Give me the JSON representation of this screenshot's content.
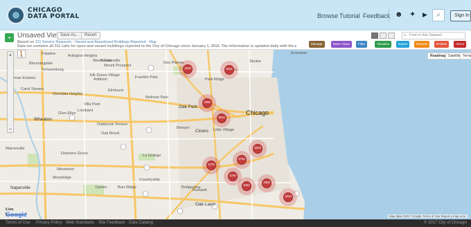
{
  "header": {
    "brand_line1": "CHICAGO",
    "brand_line2": "DATA PORTAL",
    "nav": [
      "Browse",
      "Tutorial",
      "Feedback"
    ],
    "icons": [
      "github-icon",
      "twitter-icon",
      "youtube-icon"
    ],
    "search_icon": "search-icon",
    "sign_in": "Sign In"
  },
  "toolbar": {
    "view_title": "Unsaved View",
    "save_as": "Save As...",
    "revert": "Revert",
    "based_prefix": "Based on",
    "based_link": "311 Service Requests - Vacant and Abandoned Buildings Reported - Map",
    "updated_text": "Data set contains all 311 calls for open and vacant buildings reported to the City of Chicago since January 1, 2010. The information is updated daily with the",
    "updated_more": "▸",
    "find_placeholder": "Find in this Dataset",
    "actions": [
      {
        "label": "Manage",
        "color": "#8a6437"
      },
      {
        "label": "More Views",
        "color": "#8b56c9"
      },
      {
        "label": "Filter",
        "color": "#3b83c4"
      },
      {
        "label": "Visualize",
        "color": "#2e9a4c"
      },
      {
        "label": "Export",
        "color": "#25a0d8"
      },
      {
        "label": "Discuss",
        "color": "#f08a17"
      },
      {
        "label": "Embed",
        "color": "#e3553d"
      },
      {
        "label": "About",
        "color": "#c12a2a"
      }
    ]
  },
  "map": {
    "types": [
      "Roadmap",
      "Satellite",
      "Terrain"
    ],
    "selected_type": "Roadmap",
    "places": [
      {
        "name": "Palatine",
        "cls": ""
      },
      {
        "name": "Evanston",
        "cls": ""
      },
      {
        "name": "Skokie",
        "cls": ""
      },
      {
        "name": "Des Plaines",
        "cls": ""
      },
      {
        "name": "Park Ridge",
        "cls": ""
      },
      {
        "name": "Niles",
        "cls": ""
      },
      {
        "name": "Arlington Heights",
        "cls": ""
      },
      {
        "name": "Mount Prospect",
        "cls": ""
      },
      {
        "name": "Elk Grove Village",
        "cls": ""
      },
      {
        "name": "Schaumburg",
        "cls": ""
      },
      {
        "name": "Hoffman Estates",
        "cls": ""
      },
      {
        "name": "Addison",
        "cls": ""
      },
      {
        "name": "Franklin Park",
        "cls": ""
      },
      {
        "name": "Bensenville",
        "cls": ""
      },
      {
        "name": "Wood Dale",
        "cls": ""
      },
      {
        "name": "Elmhurst",
        "cls": ""
      },
      {
        "name": "Melrose Park",
        "cls": ""
      },
      {
        "name": "Oak Park",
        "cls": "mid"
      },
      {
        "name": "Chicago",
        "cls": "city"
      },
      {
        "name": "Cicero",
        "cls": "mid"
      },
      {
        "name": "Berwyn",
        "cls": ""
      },
      {
        "name": "Villa Park",
        "cls": ""
      },
      {
        "name": "Lombard",
        "cls": ""
      },
      {
        "name": "Glen Ellyn",
        "cls": ""
      },
      {
        "name": "Wheaton",
        "cls": "mid"
      },
      {
        "name": "Oakbrook Terrace",
        "cls": ""
      },
      {
        "name": "Oak Brook",
        "cls": ""
      },
      {
        "name": "Glendale Heights",
        "cls": ""
      },
      {
        "name": "Carol Stream",
        "cls": ""
      },
      {
        "name": "Bloomingdale",
        "cls": ""
      },
      {
        "name": "Downers Grove",
        "cls": ""
      },
      {
        "name": "Westmont",
        "cls": ""
      },
      {
        "name": "Warrenville",
        "cls": ""
      },
      {
        "name": "La Grange",
        "cls": ""
      },
      {
        "name": "Darien",
        "cls": ""
      },
      {
        "name": "Burr Ridge",
        "cls": ""
      },
      {
        "name": "Countryside",
        "cls": ""
      },
      {
        "name": "Bridgeview",
        "cls": ""
      },
      {
        "name": "Burbank",
        "cls": ""
      },
      {
        "name": "Oak Lawn",
        "cls": "mid"
      },
      {
        "name": "Naperville",
        "cls": "mid"
      },
      {
        "name": "Woodridge",
        "cls": ""
      },
      {
        "name": "Little Village",
        "cls": ""
      }
    ],
    "clusters": [
      {
        "label": "1028"
      },
      {
        "label": "2841"
      },
      {
        "label": "1965"
      },
      {
        "label": "3542"
      },
      {
        "label": "2848"
      },
      {
        "label": "1376"
      },
      {
        "label": "2754"
      },
      {
        "label": "1240"
      },
      {
        "label": "4891"
      },
      {
        "label": "2859"
      },
      {
        "label": "3333"
      }
    ],
    "scale": "5 km",
    "google": "Google",
    "footer_text": "Map data ©2017 Google  Terms of Use  Report a map error"
  },
  "footer": {
    "links": [
      "Terms of Use",
      "Privacy Policy",
      "Web Standards",
      "Site Feedback",
      "Data Catalog"
    ],
    "copyright": "© 2017 City of Chicago"
  },
  "colors": {
    "header_bg": "#c8e6f5",
    "cluster": "#c43d3d",
    "lake": "#a9cfe8",
    "footer_bg": "#2c2c2c"
  }
}
